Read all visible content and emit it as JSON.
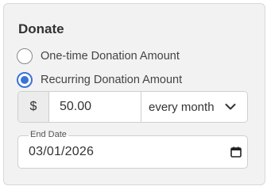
{
  "form": {
    "title": "Donate",
    "options": [
      {
        "label": "One-time Donation Amount",
        "selected": false
      },
      {
        "label": "Recurring Donation Amount",
        "selected": true
      }
    ],
    "amount": {
      "currency_symbol": "$",
      "value": "50.00"
    },
    "frequency": {
      "selected": "every month",
      "icon": "chevron-down-icon"
    },
    "end_date": {
      "label": "End Date",
      "value": "03/01/2026",
      "icon": "calendar-icon"
    }
  },
  "colors": {
    "accent": "#3b73d6",
    "card_background": "#f2f2f2",
    "border": "#cfcfcf"
  }
}
